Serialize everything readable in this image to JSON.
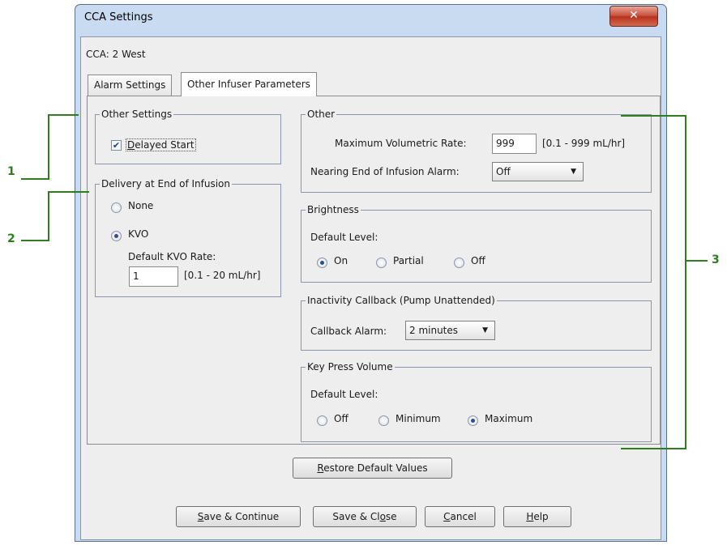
{
  "window": {
    "title": "CCA Settings",
    "close_icon": "close-icon"
  },
  "cca_label": "CCA: 2 West",
  "tabs": [
    {
      "label": "Alarm Settings",
      "active": false
    },
    {
      "label": "Other Infuser Parameters",
      "active": true
    }
  ],
  "other_settings": {
    "legend": "Other Settings",
    "delayed_start": {
      "label_first": "D",
      "label_rest": "elayed Start",
      "checked": true
    }
  },
  "delivery": {
    "legend": "Delivery at End of Infusion",
    "options": [
      {
        "label": "None",
        "selected": false
      },
      {
        "label": "KVO",
        "selected": true
      }
    ],
    "kvo_rate_label": "Default KVO Rate:",
    "kvo_rate_value": "1",
    "kvo_rate_range": "[0.1 - 20 mL/hr]"
  },
  "other": {
    "legend": "Other",
    "max_rate_label": "Maximum Volumetric Rate:",
    "max_rate_value": "999",
    "max_rate_range": "[0.1 - 999 mL/hr]",
    "nearing_end_label": "Nearing End of Infusion Alarm:",
    "nearing_end_value": "Off"
  },
  "brightness": {
    "legend": "Brightness",
    "default_level_label": "Default Level:",
    "options": [
      {
        "label": "On",
        "selected": true
      },
      {
        "label": "Partial",
        "selected": false
      },
      {
        "label": "Off",
        "selected": false
      }
    ]
  },
  "inactivity": {
    "legend": "Inactivity Callback (Pump Unattended)",
    "callback_label": "Callback Alarm:",
    "callback_value": "2 minutes"
  },
  "key_press": {
    "legend": "Key Press Volume",
    "default_level_label": "Default Level:",
    "options": [
      {
        "label": "Off",
        "selected": false
      },
      {
        "label": "Minimum",
        "selected": false
      },
      {
        "label": "Maximum",
        "selected": true
      }
    ]
  },
  "buttons": {
    "restore": {
      "mnemonic": "R",
      "rest": "estore Default Values"
    },
    "save_continue": {
      "mnemonic": "S",
      "rest": "ave & Continue"
    },
    "save_close": {
      "pre": "Save & Cl",
      "mnemonic": "o",
      "rest": "se"
    },
    "cancel": {
      "mnemonic": "C",
      "rest": "ancel"
    },
    "help": {
      "mnemonic": "H",
      "rest": "elp"
    }
  },
  "callouts": [
    "1",
    "2",
    "3"
  ],
  "colors": {
    "callout": "#2e7d1e",
    "title_bar": "#c9dbf0",
    "close_button": "#c8503c"
  }
}
